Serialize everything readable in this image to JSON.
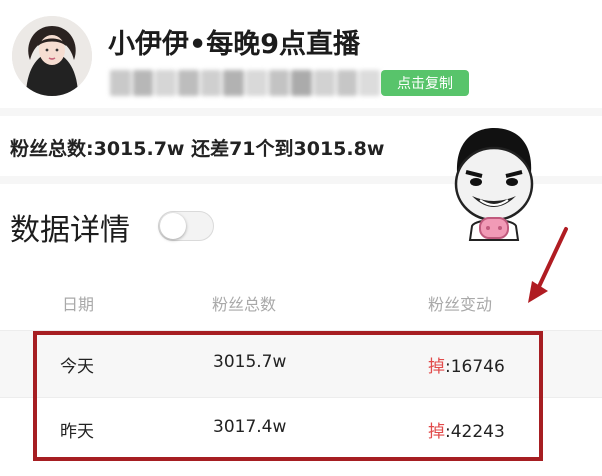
{
  "profile": {
    "title": "小伊伊•每晚9点直播",
    "copy_button_label": "点击复制"
  },
  "summary": {
    "fans_text": "粉丝总数:3015.7w 还差71个到3015.8w"
  },
  "details": {
    "title": "数据详情",
    "toggle_on": false
  },
  "table": {
    "headers": [
      "日期",
      "粉丝总数",
      "粉丝变动"
    ],
    "rows": [
      {
        "date": "今天",
        "total": "3015.7w",
        "change_label": "掉",
        "change_value": ":16746"
      },
      {
        "date": "昨天",
        "total": "3017.4w",
        "change_label": "掉",
        "change_value": ":42243"
      }
    ]
  },
  "colors": {
    "copy_button": "#58c46b",
    "drop_label": "#e14a4a",
    "highlight_box": "#a61e22",
    "arrow": "#b01c22"
  }
}
